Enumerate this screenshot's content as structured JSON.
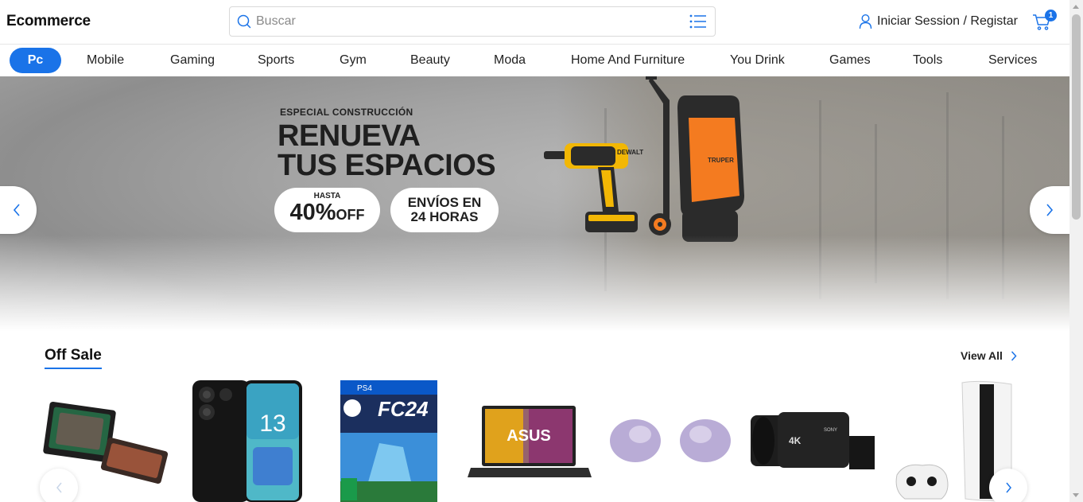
{
  "header": {
    "brand": "Ecommerce",
    "search_placeholder": "Buscar",
    "login_label": "Iniciar Session / Registar",
    "cart_count": "1"
  },
  "nav": {
    "items": [
      "Pc",
      "Mobile",
      "Gaming",
      "Sports",
      "Gym",
      "Beauty",
      "Moda",
      "Home And Furniture",
      "You Drink",
      "Games",
      "Tools",
      "Services"
    ],
    "active": "Pc"
  },
  "hero": {
    "kicker": "ESPECIAL CONSTRUCCIÓN",
    "headline_line1": "RENUEVA",
    "headline_line2": "TUS ESPACIOS",
    "promo_small": "HASTA",
    "promo_big": "40%",
    "promo_suffix": "OFF",
    "shipping_line1": "ENVÍOS EN",
    "shipping_line2": "24 HORAS",
    "drill_brand": "DEWALT",
    "washer_brand": "TRUPER",
    "slides": 4,
    "active_slide": 3
  },
  "offsale": {
    "title": "Off Sale",
    "view_all": "View All",
    "products": [
      {
        "name": "rgb-keyboard"
      },
      {
        "name": "redmi-note-13-phone",
        "screen_text": "13"
      },
      {
        "name": "fc24-ps4-game",
        "platform": "PS4",
        "title": "FC24"
      },
      {
        "name": "asus-laptop",
        "screen_text": "ASUS"
      },
      {
        "name": "galaxy-buds"
      },
      {
        "name": "sony-camcorder",
        "label": "4K",
        "brand": "SONY"
      },
      {
        "name": "ps5-console"
      }
    ]
  },
  "colors": {
    "accent": "#1a73e8",
    "washer": "#f47b20",
    "drill": "#f2b705"
  }
}
